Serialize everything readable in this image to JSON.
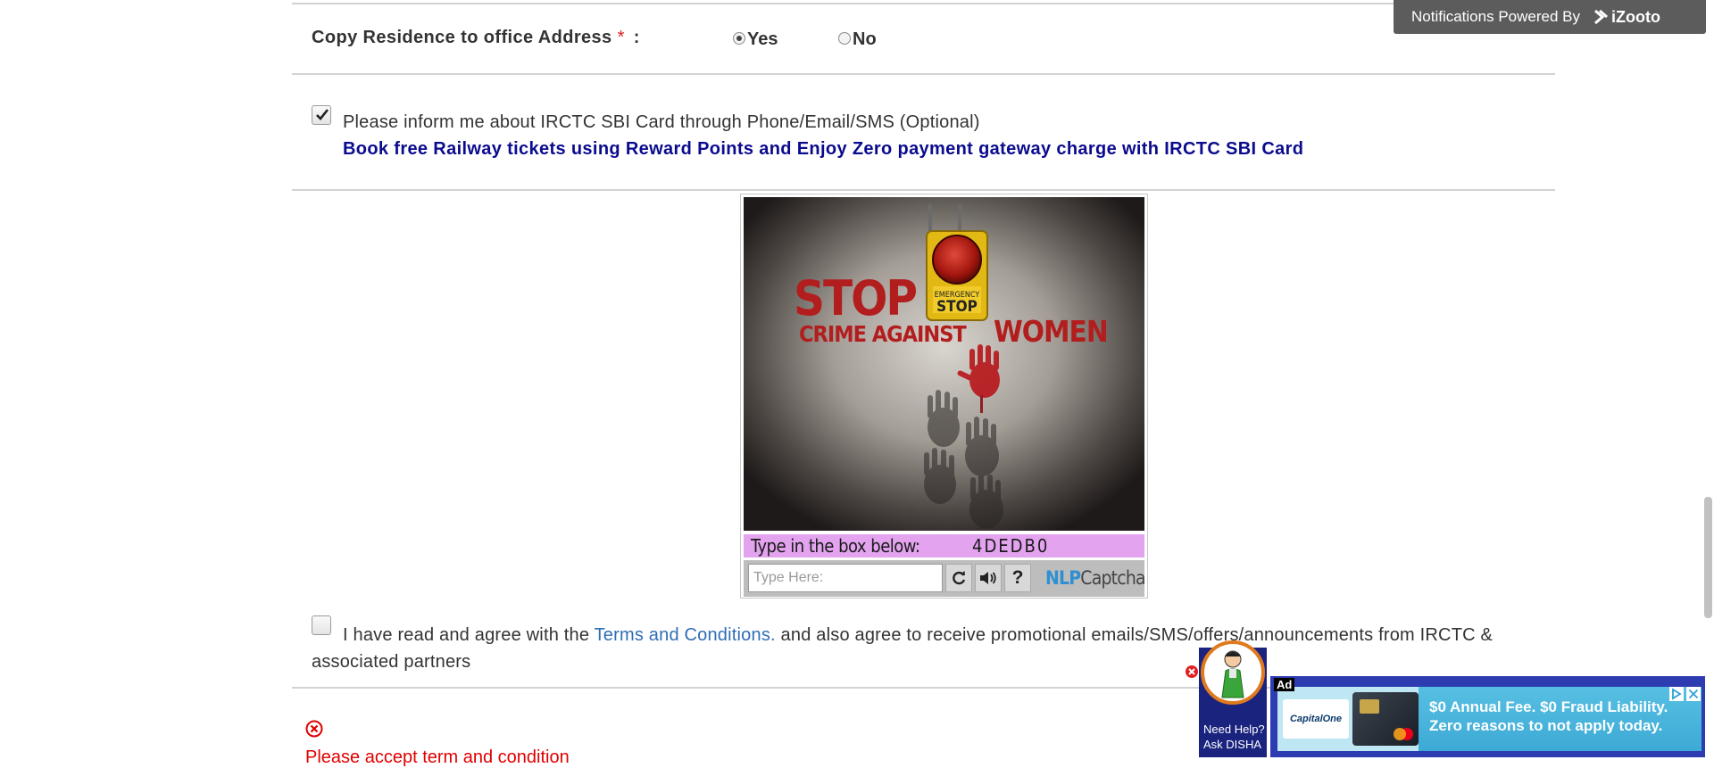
{
  "address_row": {
    "label": "Copy Residence to office Address",
    "required_mark": "*",
    "colon": ":",
    "options": [
      {
        "label": "Yes",
        "selected": true
      },
      {
        "label": "No",
        "selected": false
      }
    ]
  },
  "sbi_opt": {
    "checked": true,
    "text": "Please inform me about IRCTC SBI Card through Phone/Email/SMS (Optional)",
    "promo": "Book free Railway tickets using Reward Points and Enjoy Zero payment gateway charge with IRCTC SBI Card"
  },
  "captcha": {
    "image_headline": "STOP",
    "image_subline_1": "CRIME AGAINST",
    "image_subline_2": "WOMEN",
    "button_sign_1": "EMERGENCY",
    "button_sign_2": "STOP",
    "instruction": "Type in the box below:",
    "code": "4DEDB0",
    "input_placeholder": "Type Here:",
    "brand_prefix": "NLP",
    "brand_suffix": "Captcha",
    "refresh_icon": "refresh-icon",
    "audio_icon": "speaker-icon",
    "help_label": "?"
  },
  "terms": {
    "checked": false,
    "prefix": "I have read and agree with the",
    "link": "Terms and Conditions.",
    "suffix": "and also agree to receive promotional emails/SMS/offers/announcements from IRCTC & associated partners"
  },
  "error": {
    "text": "Please accept term and condition"
  },
  "notification_banner": {
    "text": "Notifications Powered By",
    "brand": "iZooto"
  },
  "disha": {
    "line1": "Need Help?",
    "line2": "Ask DISHA"
  },
  "ad": {
    "tag": "Ad",
    "brand": "CapitalOne",
    "line1": "$0 Annual Fee. $0 Fraud Liability.",
    "line2": "Zero reasons to not apply today."
  },
  "colors": {
    "promo_blue": "#0b0b8f",
    "error_red": "#e00000",
    "link_blue": "#2f6db5",
    "captcha_strip": "#e3a3ef"
  }
}
